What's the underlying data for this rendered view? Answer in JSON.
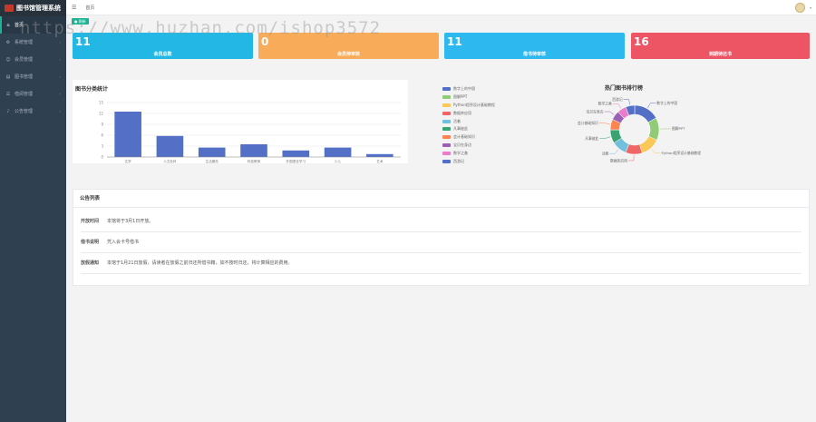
{
  "app": {
    "title": "图书馆管理系统"
  },
  "sidebar": {
    "items": [
      {
        "label": "首页",
        "icon": "home-icon",
        "glyph": "⌂",
        "active": true
      },
      {
        "label": "系统管理",
        "icon": "gear-icon",
        "glyph": "⚙",
        "active": false
      },
      {
        "label": "会员管理",
        "icon": "user-icon",
        "glyph": "☺",
        "active": false
      },
      {
        "label": "图书管理",
        "icon": "book-icon",
        "glyph": "▤",
        "active": false
      },
      {
        "label": "借阅管理",
        "icon": "list-icon",
        "glyph": "☰",
        "active": false
      },
      {
        "label": "公告管理",
        "icon": "bell-icon",
        "glyph": "♪",
        "active": false
      }
    ]
  },
  "topbar": {
    "menu_glyph": "☰",
    "tab_label": "首页"
  },
  "toolbar": {
    "refresh_label": "● 刷新"
  },
  "cards": [
    {
      "value": "11",
      "label": "会员总数",
      "color": "#23b7e5"
    },
    {
      "value": "0",
      "label": "会员待审核",
      "color": "#f8ac59"
    },
    {
      "value": "11",
      "label": "借书待审核",
      "color": "#2eb8f0"
    },
    {
      "value": "16",
      "label": "到期待还书",
      "color": "#ed5565"
    }
  ],
  "bar_panel": {
    "title": "图书分类统计"
  },
  "pie_panel": {
    "title": "热门图书排行榜"
  },
  "chart_data": [
    {
      "type": "bar",
      "title": "图书分类统计",
      "categories": [
        "文学",
        "人文社科",
        "生活服务",
        "科技教育",
        "外国语言学习",
        "少儿",
        "艺术"
      ],
      "values": [
        12.5,
        5.8,
        2.6,
        3.5,
        1.8,
        2.6,
        0.8
      ],
      "ylim": [
        0,
        15
      ],
      "yticks": [
        "0",
        "3",
        "6",
        "9",
        "12",
        "15"
      ],
      "color": "#5470c6"
    },
    {
      "type": "pie",
      "title": "热门图书排行榜",
      "donut": true,
      "labels": [
        "数字上的中国",
        "图解PPT",
        "Python程序设计基础教程",
        "数据库应用",
        "活着",
        "凡事彼此",
        "会计基础知识",
        "宝贝在身边",
        "数学之美",
        "西游记"
      ],
      "values": [
        17,
        15,
        13,
        11,
        10,
        9,
        7,
        6,
        6,
        6
      ],
      "colors": [
        "#5470c6",
        "#91cc75",
        "#fac858",
        "#ee6666",
        "#73c0de",
        "#3ba272",
        "#fc8452",
        "#9a60b4",
        "#ea7ccc",
        "#5470c6"
      ]
    }
  ],
  "notice": {
    "title": "公告列表",
    "rows": [
      {
        "title": "开放时间",
        "content": "本馆将于3月1日开放。"
      },
      {
        "title": "借书说明",
        "content": "凭入会卡号借书"
      },
      {
        "title": "放假通知",
        "content": "本馆于1月21日放假，请读者在放假之前归还所借书籍，如不按时归还，将计算相应的费用。"
      }
    ]
  },
  "watermark": "https://www.huzhan.com/ishop3572"
}
